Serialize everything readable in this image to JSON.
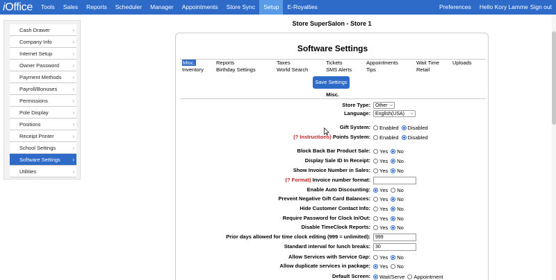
{
  "app": {
    "logo_prefix": "i",
    "logo_suffix": "Office"
  },
  "nav": {
    "items": [
      "Tools",
      "Sales",
      "Reports",
      "Scheduler",
      "Manager",
      "Appointments",
      "Store Sync",
      "Setup",
      "E-Royalties"
    ],
    "active": "Setup",
    "preferences": "Preferences",
    "greeting": "Hello Kory Lamme",
    "signout": "Sign out"
  },
  "sidebar": {
    "items": [
      {
        "label": "Cash Drawer"
      },
      {
        "label": "Company Info"
      },
      {
        "label": "Internet Setup"
      },
      {
        "label": "Owner Password"
      },
      {
        "label": "Payment Methods"
      },
      {
        "label": "Payroll/Bonuses"
      },
      {
        "label": "Permissions"
      },
      {
        "label": "Pole Display"
      },
      {
        "label": "Positions"
      },
      {
        "label": "Receipt Printer"
      },
      {
        "label": "School Settings"
      },
      {
        "label": "Software Settings"
      },
      {
        "label": "Utilities"
      }
    ],
    "active": "Software Settings"
  },
  "header": {
    "store_title": "Store SuperSalon - Store 1"
  },
  "panel": {
    "title": "Software Settings",
    "tabs": [
      {
        "label": "Misc."
      },
      {
        "label": "Reports"
      },
      {
        "label": "Taxes"
      },
      {
        "label": "Tickets"
      },
      {
        "label": "Appointments"
      },
      {
        "label": "Wait Time"
      },
      {
        "label": "Uploads"
      },
      {
        "label": "Inventory"
      },
      {
        "label": "Birthday Settings"
      },
      {
        "label": "World Search"
      },
      {
        "label": "SMS Alerts"
      },
      {
        "label": "Tips"
      },
      {
        "label": "Retail"
      }
    ],
    "save_label": "Save Settings",
    "section_title": "Misc."
  },
  "form": {
    "store_type": {
      "label": "Store Type:",
      "value": "Other"
    },
    "language": {
      "label": "Language:",
      "value": "English(USA)"
    },
    "gift_system": {
      "label": "Gift System:",
      "opt1": "Enabled",
      "opt2": "Disabled"
    },
    "points_system": {
      "help": "(? Instructions)",
      "label": "Points System:",
      "opt1": "Enabled",
      "opt2": "Disabled"
    },
    "block_back_bar": {
      "label": "Block Back Bar Product Sale:",
      "opt1": "Yes",
      "opt2": "No"
    },
    "display_sale_id": {
      "label": "Display Sale ID In Receipt:",
      "opt1": "Yes",
      "opt2": "No"
    },
    "show_invoice_number": {
      "label": "Show Invoice Number in Sales:",
      "opt1": "Yes",
      "opt2": "No"
    },
    "invoice_format": {
      "help": "(? Format)",
      "label": "Invoice number format:",
      "value": ""
    },
    "enable_auto_discounting": {
      "label": "Enable Auto Discounting:",
      "opt1": "Yes",
      "opt2": "No"
    },
    "prevent_negative_gift": {
      "label": "Prevent Negative Gift Card Balances:",
      "opt1": "Yes",
      "opt2": "No"
    },
    "hide_customer_contact": {
      "label": "Hide Customer Contact Info:",
      "opt1": "Yes",
      "opt2": "No"
    },
    "require_password_clock": {
      "label": "Require Password for Clock In/Out:",
      "opt1": "Yes",
      "opt2": "No"
    },
    "disable_timeclock_reports": {
      "label": "Disable TimeClock Reports:",
      "opt1": "Yes",
      "opt2": "No"
    },
    "prior_days_editing": {
      "label": "Prior days allowed for time clock editing (999 = unlimited):",
      "value": "999"
    },
    "lunch_interval": {
      "label": "Standard interval for lunch breaks:",
      "value": "30"
    },
    "allow_service_gap": {
      "label": "Allow Services with Service Gap:",
      "opt1": "Yes",
      "opt2": "No"
    },
    "allow_duplicate_services": {
      "label": "Allow duplicate services in package:",
      "opt1": "Yes",
      "opt2": "No"
    },
    "default_screen": {
      "label": "Default Screen:",
      "opt1": "Wait/Serve",
      "opt2": "Appointment"
    }
  },
  "colors": {
    "nav_bg": "#2e6bc9",
    "nav_active": "#5a9be8",
    "accent": "#2e6bc9",
    "help_red": "#b22222"
  }
}
